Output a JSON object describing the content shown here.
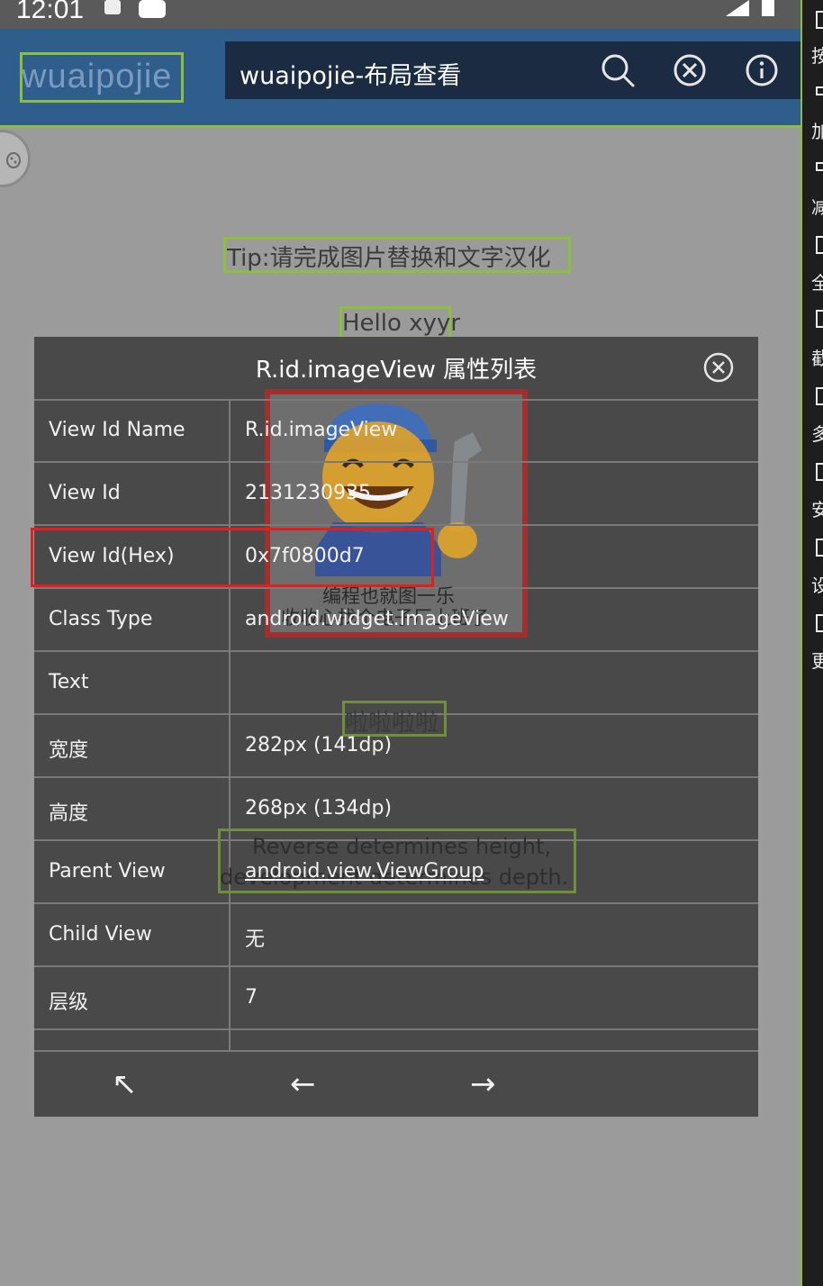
{
  "status_bar": {
    "time": "12:01"
  },
  "app_bar": {
    "brand": "wuaipojie",
    "search_title": "wuaipojie-布局查看"
  },
  "right_panel": {
    "chars": [
      "按",
      "加",
      "减",
      "全",
      "截",
      "多",
      "安",
      "设",
      "更"
    ]
  },
  "background": {
    "tip": "Tip:请完成图片替换和文字汉化",
    "hello": "Hello xyyr",
    "image_caption_line1": "编程也就图一乐",
    "image_caption_line2": "收收心找个电子厂上班了",
    "lala": "啦啦啦啦",
    "quote_line1": "Reverse determines height,",
    "quote_line2": "development determines depth."
  },
  "dialog": {
    "title": "R.id.imageView 属性列表",
    "rows": [
      {
        "label": "View Id Name",
        "value": "R.id.imageView"
      },
      {
        "label": "View Id",
        "value": "2131230935"
      },
      {
        "label": "View Id(Hex)",
        "value": "0x7f0800d7"
      },
      {
        "label": "Class Type",
        "value": "android.widget.ImageView"
      },
      {
        "label": "Text",
        "value": ""
      },
      {
        "label": "宽度",
        "value": "282px (141dp)"
      },
      {
        "label": "高度",
        "value": "268px (134dp)"
      },
      {
        "label": "Parent View",
        "value": "android.view.ViewGroup"
      },
      {
        "label": "Child View",
        "value": "无"
      },
      {
        "label": "层级",
        "value": "7"
      }
    ],
    "nav": {
      "up": "↖",
      "back": "←",
      "forward": "→"
    }
  },
  "colors": {
    "app_bar": "#2f5e8c",
    "highlight": "#8cbf3a",
    "selection": "#e02020",
    "dialog_bg": "#464646"
  },
  "icons": [
    "search-icon",
    "close-circle-icon",
    "info-icon",
    "bug-icon",
    "dialog-close-icon"
  ]
}
